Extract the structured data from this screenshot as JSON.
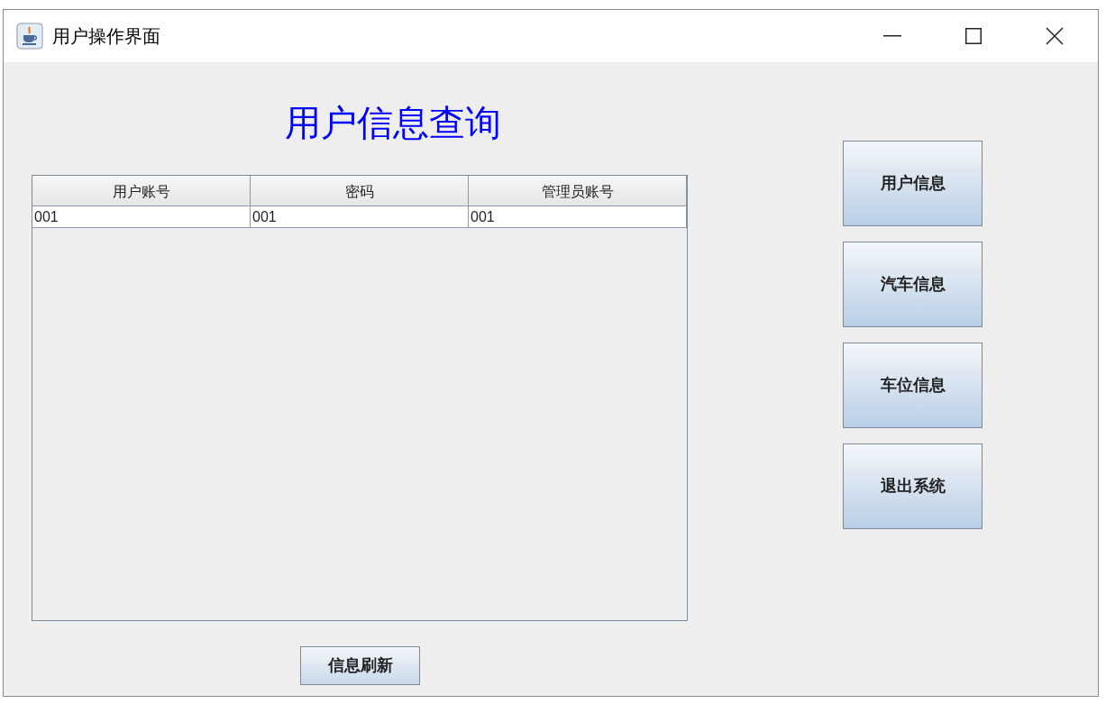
{
  "window": {
    "title": "用户操作界面"
  },
  "heading": "用户信息查询",
  "table": {
    "columns": [
      "用户账号",
      "密码",
      "管理员账号"
    ],
    "rows": [
      [
        "001",
        "001",
        "001"
      ]
    ]
  },
  "side_buttons": [
    "用户信息",
    "汽车信息",
    "车位信息",
    "退出系统"
  ],
  "refresh_button": "信息刷新"
}
